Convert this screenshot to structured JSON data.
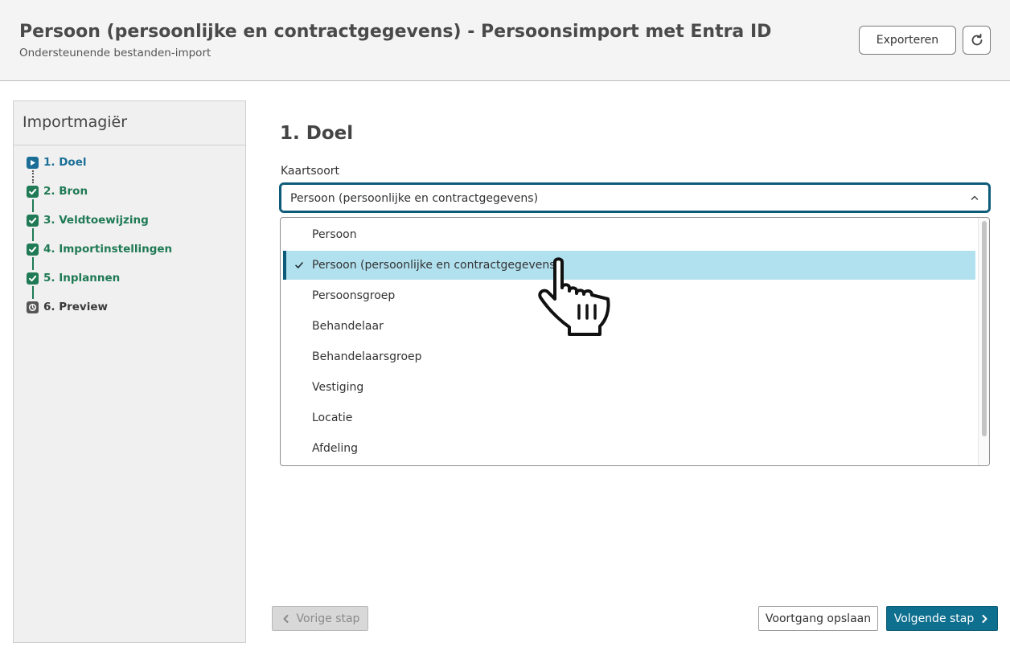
{
  "header": {
    "title": "Persoon (persoonlijke en contractgegevens) - Persoonsimport met Entra ID",
    "subtitle": "Ondersteunende bestanden-import",
    "export_label": "Exporteren",
    "refresh_icon": "refresh-icon"
  },
  "sidebar": {
    "title": "Importmagiër",
    "steps": [
      {
        "label": "1. Doel",
        "state": "active"
      },
      {
        "label": "2. Bron",
        "state": "done"
      },
      {
        "label": "3. Veldtoewijzing",
        "state": "done"
      },
      {
        "label": "4. Importinstellingen",
        "state": "done"
      },
      {
        "label": "5. Inplannen",
        "state": "done"
      },
      {
        "label": "6. Preview",
        "state": "pending"
      }
    ]
  },
  "main": {
    "title": "1. Doel",
    "field_label": "Kaartsoort",
    "select_value": "Persoon (persoonlijke en contractgegevens)",
    "options": [
      {
        "label": "Persoon",
        "selected": false
      },
      {
        "label": "Persoon (persoonlijke en contractgegevens)",
        "selected": true
      },
      {
        "label": "Persoonsgroep",
        "selected": false
      },
      {
        "label": "Behandelaar",
        "selected": false
      },
      {
        "label": "Behandelaarsgroep",
        "selected": false
      },
      {
        "label": "Vestiging",
        "selected": false
      },
      {
        "label": "Locatie",
        "selected": false
      },
      {
        "label": "Afdeling",
        "selected": false
      }
    ]
  },
  "footer": {
    "prev_label": "Vorige stap",
    "save_label": "Voortgang opslaan",
    "next_label": "Volgende stap"
  },
  "colors": {
    "primary": "#0e6f8f",
    "active_step": "#1b6f97",
    "done_step": "#1f7a55",
    "selected_option_bg": "#b1e1ef"
  }
}
